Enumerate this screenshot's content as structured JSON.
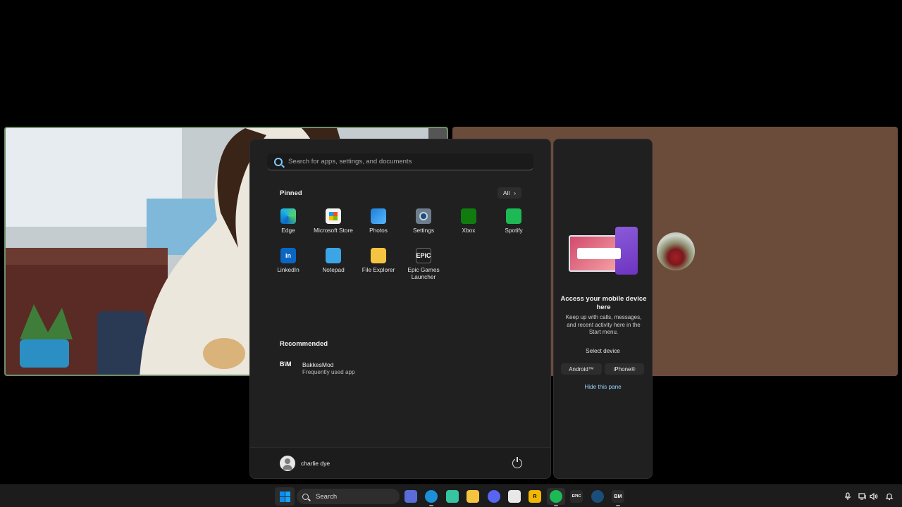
{
  "start_menu": {
    "search_placeholder": "Search for apps, settings, and documents",
    "pinned_title": "Pinned",
    "all_label": "All",
    "all_chevron": "›",
    "pinned_apps": [
      {
        "label": "Edge",
        "icon": "edge-icon"
      },
      {
        "label": "Microsoft Store",
        "icon": "microsoft-store-icon"
      },
      {
        "label": "Photos",
        "icon": "photos-icon"
      },
      {
        "label": "Settings",
        "icon": "settings-gear-icon"
      },
      {
        "label": "Xbox",
        "icon": "xbox-icon"
      },
      {
        "label": "Spotify",
        "icon": "spotify-icon"
      },
      {
        "label": "LinkedIn",
        "icon": "linkedin-icon",
        "glyph": "in"
      },
      {
        "label": "Notepad",
        "icon": "notepad-icon"
      },
      {
        "label": "File Explorer",
        "icon": "file-explorer-icon"
      },
      {
        "label": "Epic Games Launcher",
        "icon": "epic-games-icon",
        "glyph": "EPIC"
      }
    ],
    "recommended_title": "Recommended",
    "recommended": [
      {
        "name": "BakkesMod",
        "subtitle": "Frequently used app",
        "icon": "bakkesmod-icon",
        "glyph": "B\\M"
      }
    ],
    "user_name": "charlie dye"
  },
  "phone_panel": {
    "title": "Access your mobile device here",
    "description": "Keep up with calls, messages, and recent activity here in the Start menu.",
    "select_device": "Select device",
    "android_label": "Android™",
    "iphone_label": "iPhone®",
    "hide_label": "Hide this pane"
  },
  "taskbar": {
    "search_label": "Search",
    "pinned": [
      {
        "name": "game-controller-icon",
        "color": "#5b6cd9"
      },
      {
        "name": "edge-icon",
        "color": "#1c8fd8"
      },
      {
        "name": "chat-app-icon",
        "color": "#37c4a0"
      },
      {
        "name": "file-explorer-icon",
        "color": "#f5c542"
      },
      {
        "name": "discord-icon",
        "color": "#5865f2"
      },
      {
        "name": "microsoft-store-icon",
        "color": "#e8e8e8"
      },
      {
        "name": "rockstar-launcher-icon",
        "color": "#f2b705",
        "glyph": "R"
      },
      {
        "name": "spotify-icon",
        "color": "#1db954"
      },
      {
        "name": "epic-games-icon",
        "color": "#2a2a2a",
        "glyph": "EPIC"
      },
      {
        "name": "steam-icon",
        "color": "#1b4d7a"
      },
      {
        "name": "bakkesmod-icon",
        "color": "#2a2a2a",
        "glyph": "BM"
      }
    ],
    "tray": [
      "microphone-icon",
      "network-icon",
      "volume-icon",
      "notification-icon"
    ]
  },
  "colors": {
    "accent": "#99d8ff",
    "start_bg": "#202020",
    "taskbar_bg": "#1c1c1c",
    "remote_tile_bg": "#6b4c3b"
  }
}
